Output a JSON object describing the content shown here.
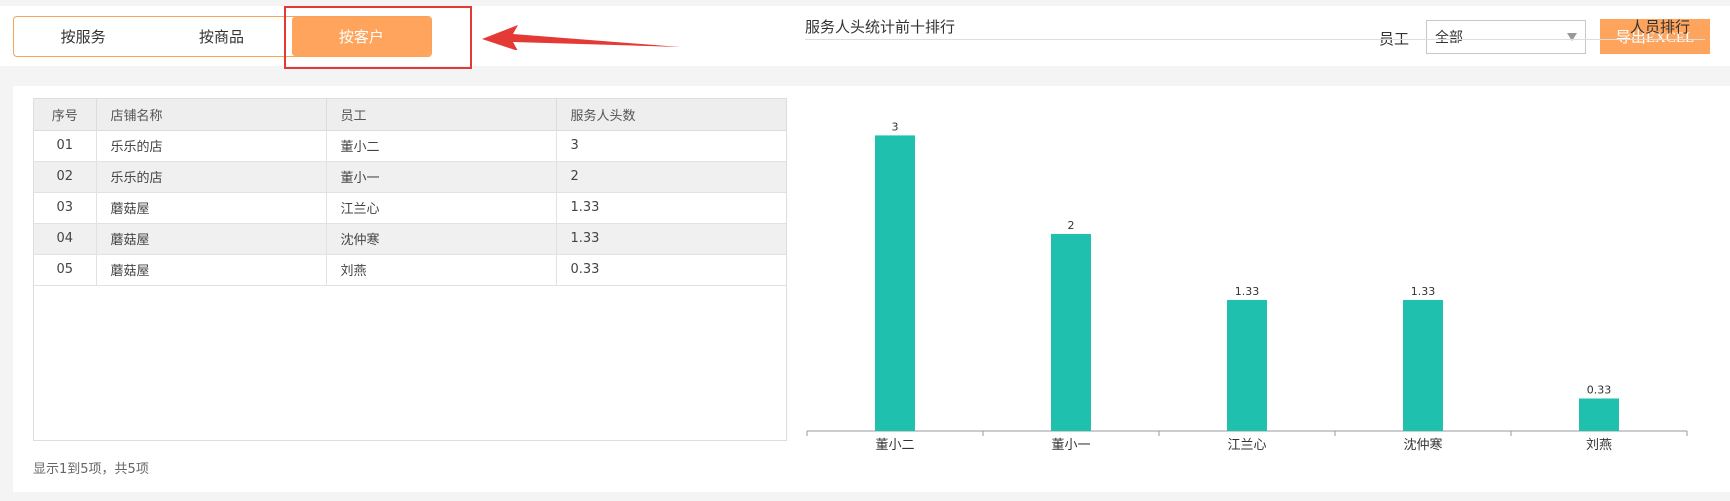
{
  "tabs": [
    {
      "label": "按服务",
      "active": false
    },
    {
      "label": "按商品",
      "active": false
    },
    {
      "label": "按客户",
      "active": true
    }
  ],
  "filter": {
    "label": "员工",
    "selected": "全部"
  },
  "export_label": "导出EXCEL",
  "colors": {
    "accent": "#ffa45c",
    "bar": "#1fc0ae",
    "highlight": "#e53935"
  },
  "table": {
    "headers": [
      "序号",
      "店铺名称",
      "员工",
      "服务人头数"
    ],
    "rows": [
      [
        "01",
        "乐乐的店",
        "董小二",
        "3"
      ],
      [
        "02",
        "乐乐的店",
        "董小一",
        "2"
      ],
      [
        "03",
        "蘑菇屋",
        "江兰心",
        "1.33"
      ],
      [
        "04",
        "蘑菇屋",
        "沈仲寒",
        "1.33"
      ],
      [
        "05",
        "蘑菇屋",
        "刘燕",
        "0.33"
      ]
    ]
  },
  "pagination_text": "显示1到5项，共5项",
  "chart_panel": {
    "title": "服务人头统计前十排行",
    "link": "人员排行"
  },
  "chart_data": {
    "type": "bar",
    "title": "服务人头统计前十排行",
    "categories": [
      "董小二",
      "董小一",
      "江兰心",
      "沈仲寒",
      "刘燕"
    ],
    "values": [
      3,
      2,
      1.33,
      1.33,
      0.33
    ],
    "value_labels": [
      "3",
      "2",
      "1.33",
      "1.33",
      "0.33"
    ],
    "xlabel": "",
    "ylabel": "",
    "ylim": [
      0,
      3.4
    ],
    "grid": false,
    "legend": "none"
  }
}
